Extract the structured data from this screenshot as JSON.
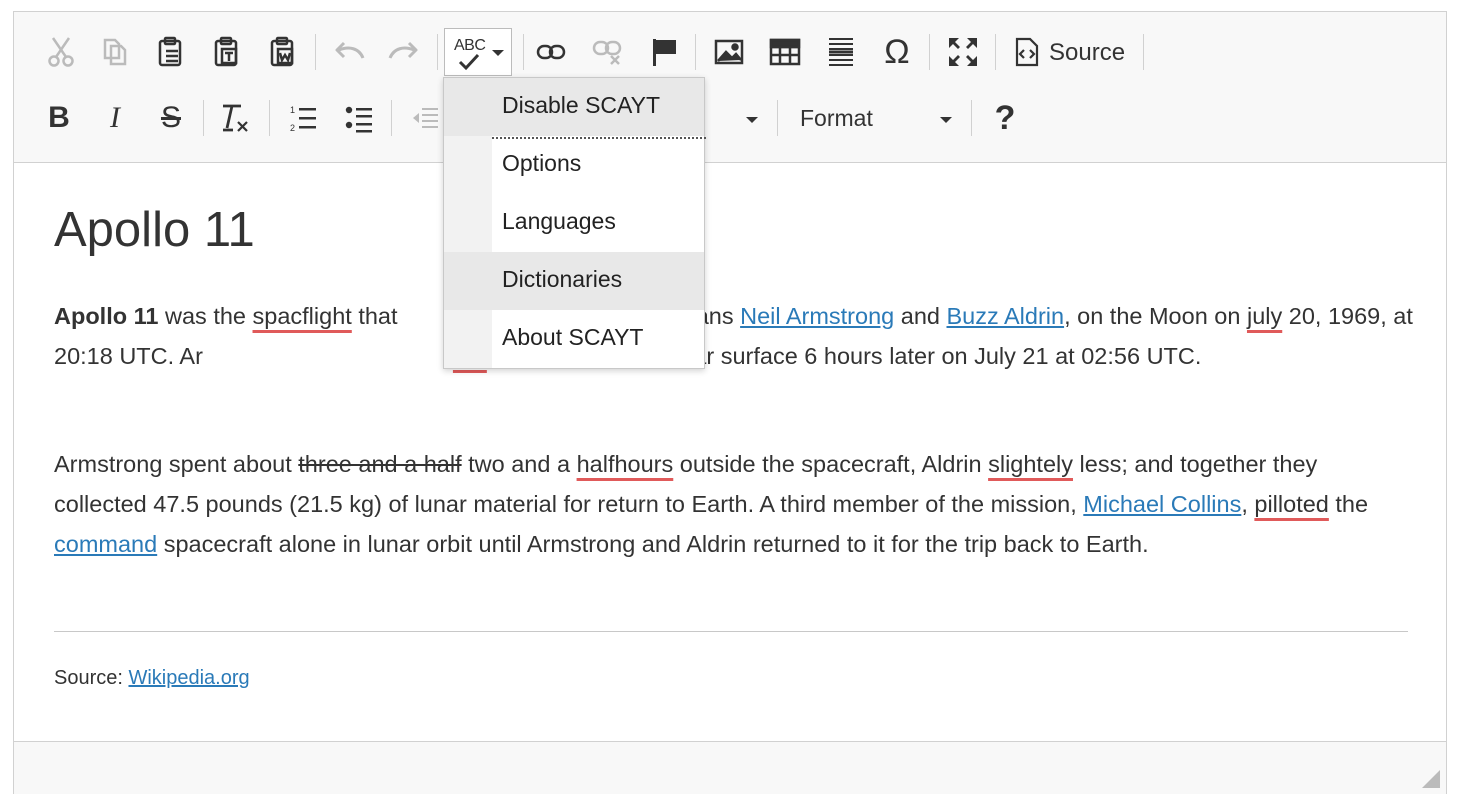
{
  "toolbar": {
    "row1": [
      {
        "name": "cut-icon",
        "label": "Cut",
        "enabled": false
      },
      {
        "name": "copy-icon",
        "label": "Copy",
        "enabled": false
      },
      {
        "name": "paste-icon",
        "label": "Paste",
        "enabled": true
      },
      {
        "name": "paste-text-icon",
        "label": "Paste as plain text",
        "enabled": true
      },
      {
        "name": "paste-word-icon",
        "label": "Paste from Word",
        "enabled": true
      },
      {
        "name": "undo-icon",
        "label": "Undo",
        "enabled": false
      },
      {
        "name": "redo-icon",
        "label": "Redo",
        "enabled": false
      },
      {
        "name": "spellcheck-icon",
        "label": "Spell Checker",
        "enabled": true
      },
      {
        "name": "link-icon",
        "label": "Link",
        "enabled": true
      },
      {
        "name": "unlink-icon",
        "label": "Unlink",
        "enabled": false
      },
      {
        "name": "anchor-flag-icon",
        "label": "Anchor",
        "enabled": true
      },
      {
        "name": "image-icon",
        "label": "Image",
        "enabled": true
      },
      {
        "name": "table-icon",
        "label": "Table",
        "enabled": true
      },
      {
        "name": "horizontal-line-icon",
        "label": "Horizontal Line",
        "enabled": true
      },
      {
        "name": "special-char-icon",
        "label": "Special Character",
        "enabled": true
      },
      {
        "name": "maximize-icon",
        "label": "Maximize",
        "enabled": true
      },
      {
        "name": "source-icon",
        "label": "Source",
        "enabled": true
      }
    ],
    "source_label": "Source",
    "spellcheck_glyph": "ABC",
    "special_char_glyph": "Ω",
    "help_glyph": "?",
    "format_label": "Format"
  },
  "scayt_menu": {
    "items": [
      {
        "label": "Disable SCAYT",
        "highlighted": true
      },
      {
        "label": "Options",
        "highlighted": false
      },
      {
        "label": "Languages",
        "highlighted": false
      },
      {
        "label": "Dictionaries",
        "highlighted": true
      },
      {
        "label": "About SCAYT",
        "highlighted": false
      }
    ]
  },
  "content": {
    "title": "Apollo 11",
    "p1": {
      "bold": "Apollo 11",
      "t1": " was the ",
      "sp1": "spacflight",
      "t2": " that ",
      "t3": "s, Americans ",
      "link1": "Neil Armstrong",
      "t4": " and ",
      "link2": "Buzz Aldrin",
      "t5": ", on the Moon on ",
      "sp2": "july",
      "t6": " 20, 1969, at 20:18 UTC. Ar",
      "sp3": "rrst",
      "t7": " to step onto the lunar surface 6 hours later on July 21 at 02:56 UTC."
    },
    "p2": {
      "t1": "Armstrong spent about ",
      "strike": "three and a half",
      "t2": " two and a ",
      "sp1": "halfhours",
      "t3": " outside the spacecraft, Aldrin ",
      "sp2": "slightely",
      "t4": " less; and together they collected 47.5 pounds (21.5 kg) of lunar material for return to Earth. A third member of the mission, ",
      "link1": "Michael Collins",
      "t5": ", ",
      "sp3": "pilloted",
      "t6": " the ",
      "link2": "command",
      "t7": " spacecraft alone in lunar orbit until Armstrong and Aldrin returned to it for the trip back to Earth."
    },
    "source_prefix": "Source: ",
    "source_link": "Wikipedia.org"
  },
  "colors": {
    "link": "#2a7ab8",
    "spellcheck_underline": "#e05a5a",
    "toolbar_bg": "#f8f8f8",
    "menu_highlight": "#e8e8e8"
  }
}
